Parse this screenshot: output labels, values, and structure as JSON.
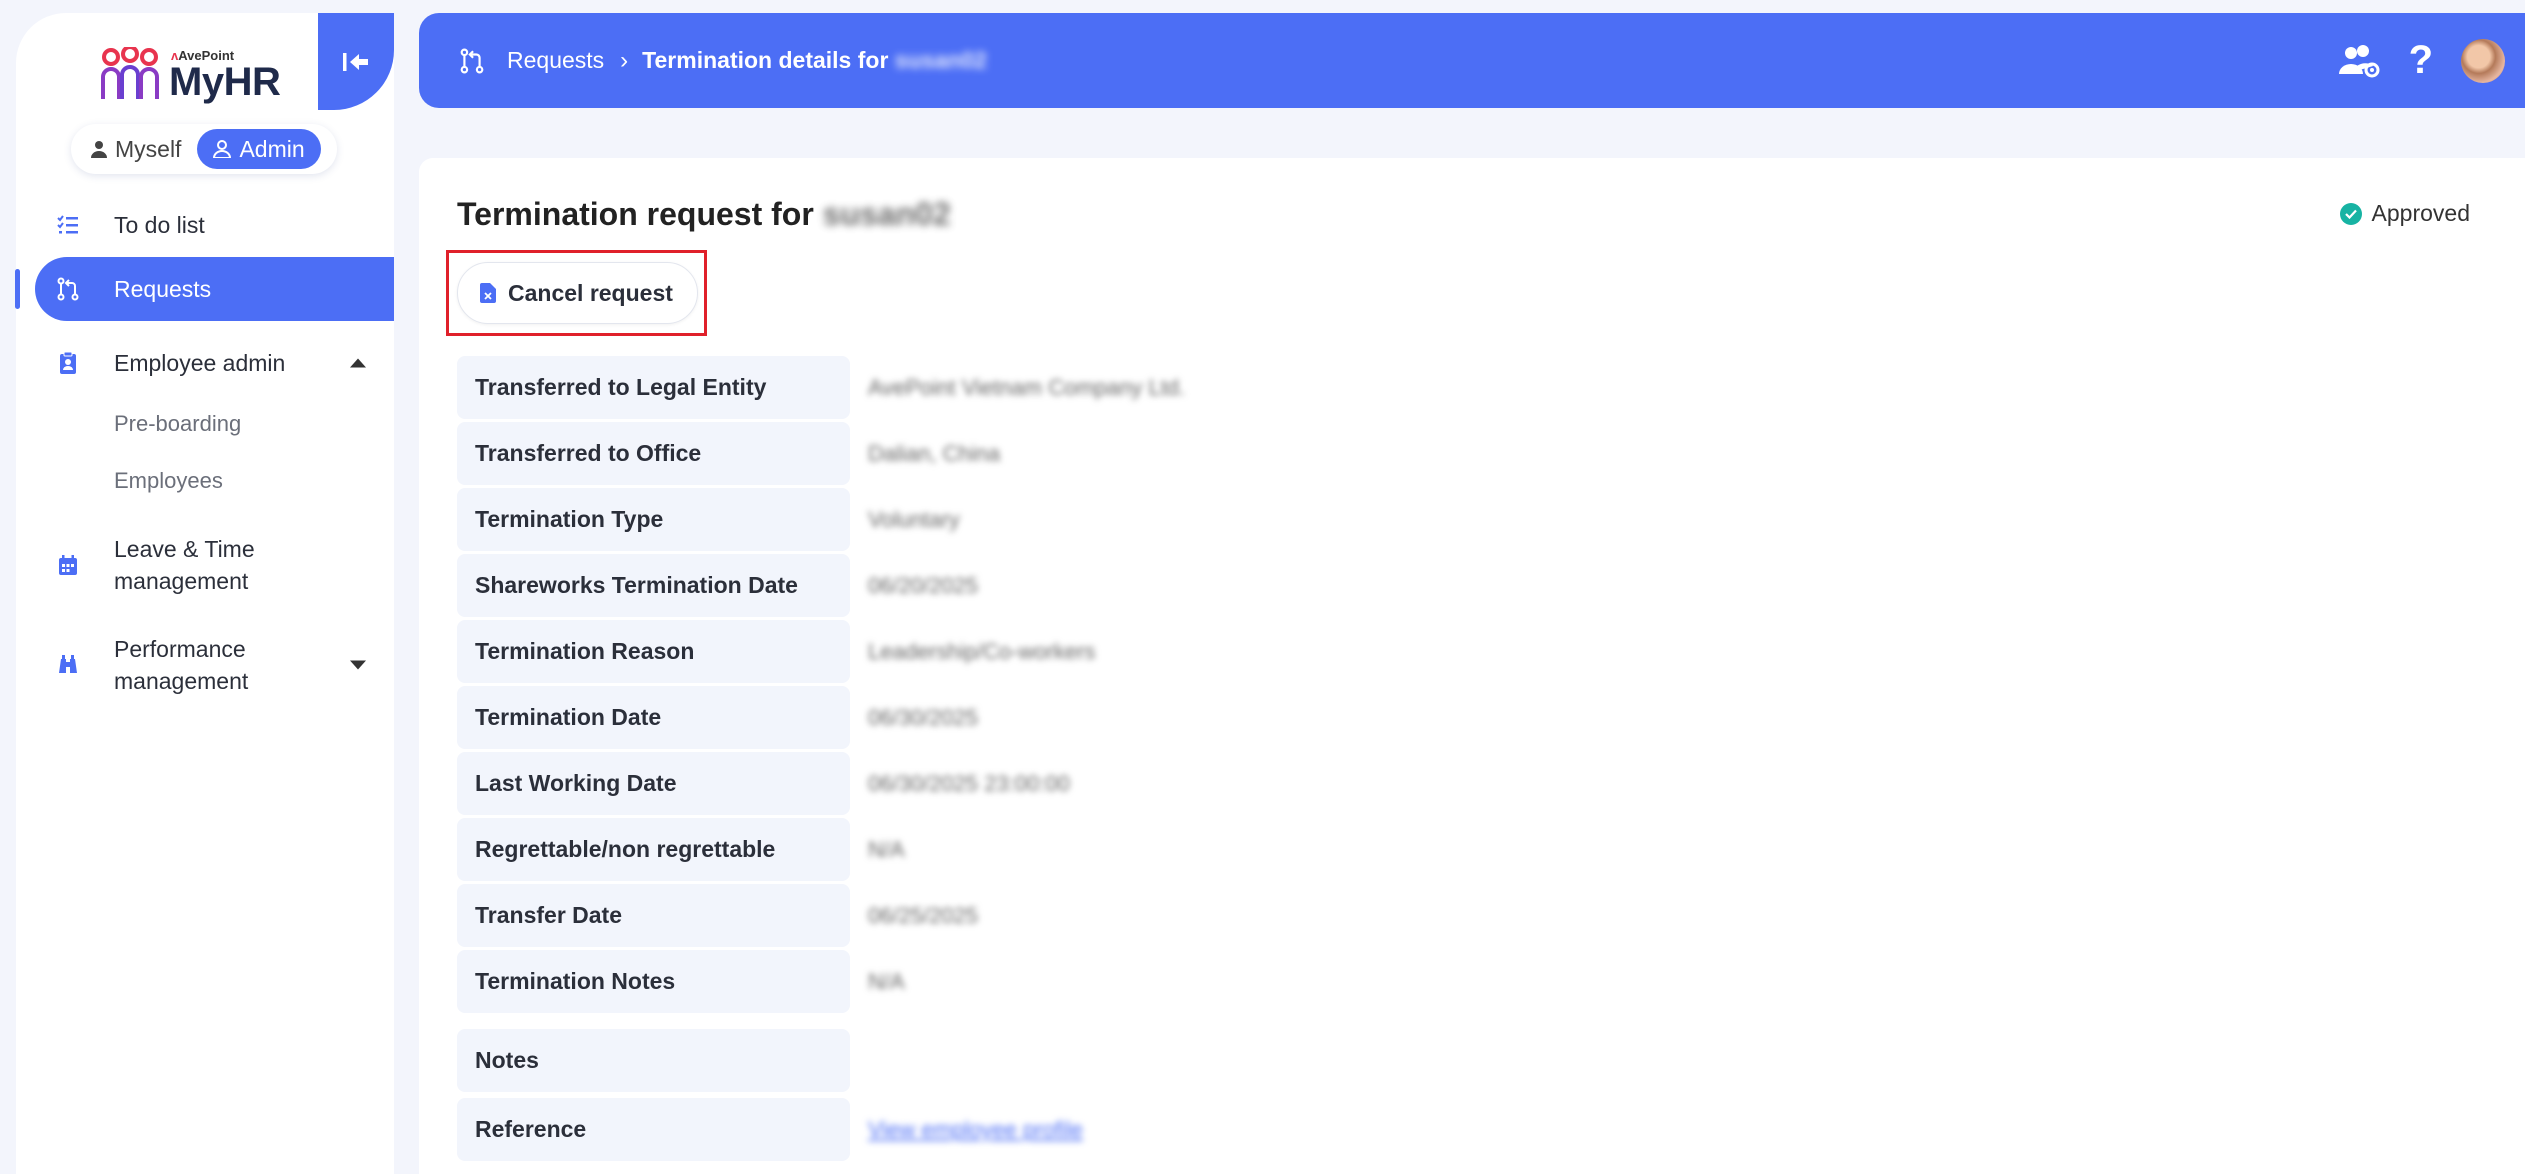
{
  "app": {
    "logo_brand": "AvePoint",
    "logo_name": "MyHR"
  },
  "role_switch": {
    "myself": "Myself",
    "admin": "Admin"
  },
  "sidebar": {
    "items": [
      {
        "label": "To do list"
      },
      {
        "label": "Requests"
      },
      {
        "label": "Employee admin"
      },
      {
        "label": "Pre-boarding"
      },
      {
        "label": "Employees"
      },
      {
        "label": "Leave & Time management"
      },
      {
        "label": "Performance management"
      }
    ]
  },
  "header": {
    "crumb_root": "Requests",
    "crumb_current": "Termination details for",
    "crumb_user": "susan02"
  },
  "main": {
    "title": "Termination request for",
    "title_user": "susan02",
    "status": "Approved",
    "cancel_label": "Cancel request",
    "fields": [
      {
        "label": "Transferred to Legal Entity",
        "value": "AvePoint Vietnam Company Ltd."
      },
      {
        "label": "Transferred to Office",
        "value": "Dalian, China"
      },
      {
        "label": "Termination Type",
        "value": "Voluntary"
      },
      {
        "label": "Shareworks Termination Date",
        "value": "06/20/2025"
      },
      {
        "label": "Termination Reason",
        "value": "Leadership/Co-workers"
      },
      {
        "label": "Termination Date",
        "value": "06/30/2025"
      },
      {
        "label": "Last Working Date",
        "value": "06/30/2025 23:00:00"
      },
      {
        "label": "Regrettable/non regrettable",
        "value": "N/A"
      },
      {
        "label": "Transfer Date",
        "value": "06/25/2025"
      },
      {
        "label": "Termination Notes",
        "value": "N/A"
      },
      {
        "label": "Notes",
        "value": ""
      },
      {
        "label": "Reference",
        "value": "View employee profile"
      }
    ]
  },
  "colors": {
    "accent": "#4c6ef5",
    "approved": "#17b3a3",
    "highlight": "#e0202a"
  }
}
